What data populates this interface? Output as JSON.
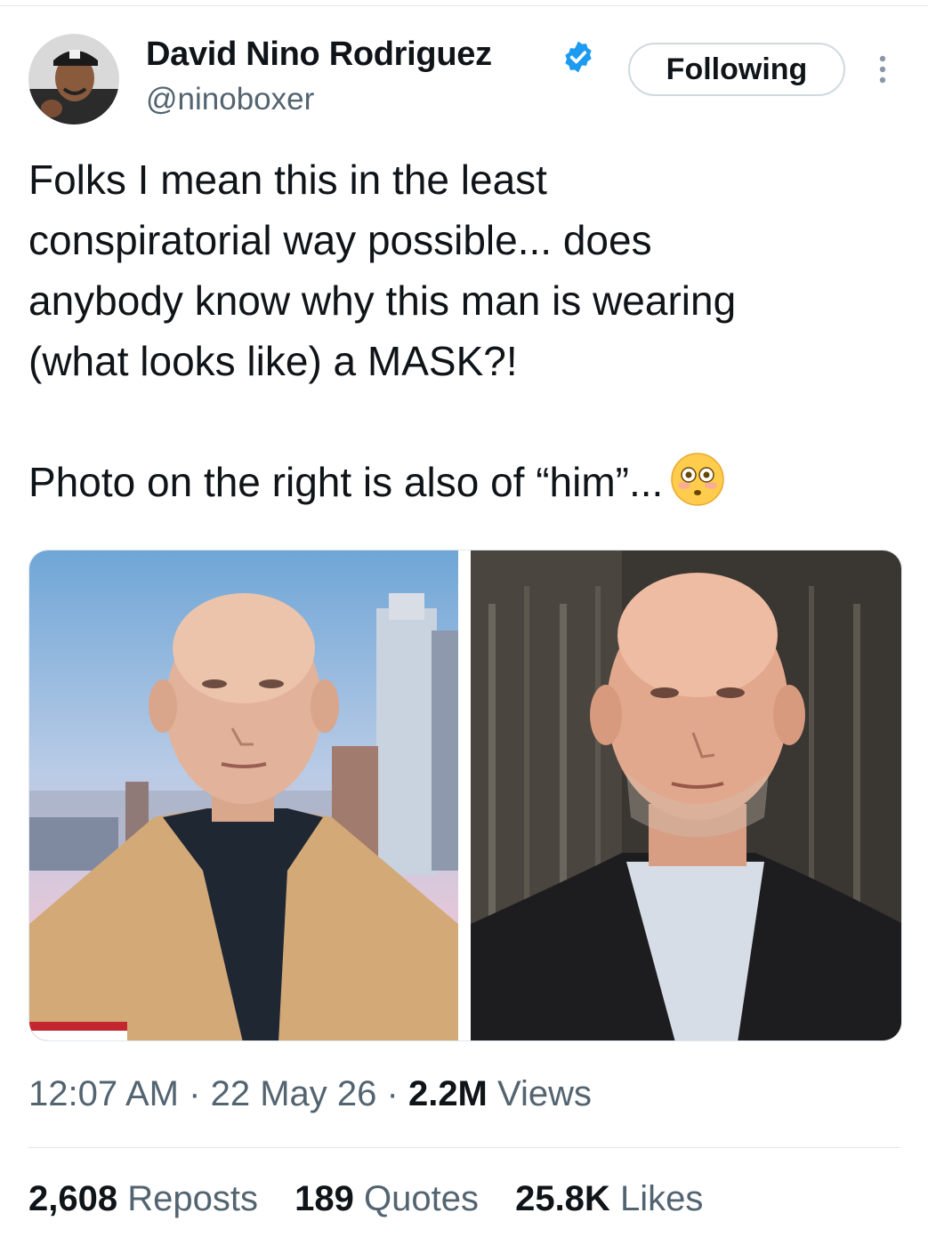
{
  "author": {
    "name": "David Nino Rodriguez",
    "handle": "@ninoboxer",
    "verified": true,
    "follow_button_label": "Following"
  },
  "tweet": {
    "lines": [
      "Folks I mean this in the least",
      "conspiratorial way possible... does",
      "anybody know why this man is wearing",
      "(what looks like) a MASK?!"
    ],
    "second_paragraph": "Photo on the right is also of “him”...",
    "emoji": "flushed-face-emoji"
  },
  "media": {
    "photo_count": 2
  },
  "meta": {
    "time": "12:07 AM",
    "separator": "·",
    "date": "22 May 26",
    "views_count": "2.2M",
    "views_label": "Views"
  },
  "stats": {
    "reposts_count": "2,608",
    "reposts_label": "Reposts",
    "quotes_count": "189",
    "quotes_label": "Quotes",
    "likes_count": "25.8K",
    "likes_label": "Likes"
  },
  "colors": {
    "text_primary": "#0f1419",
    "text_secondary": "#536471",
    "verified_blue": "#1d9bf0",
    "border": "#cfd9de"
  },
  "icons": {
    "verified": "verified-badge-icon",
    "more": "more-vertical-icon"
  }
}
